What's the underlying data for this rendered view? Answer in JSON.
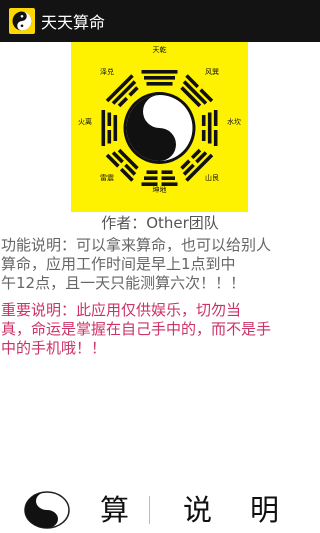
{
  "app": {
    "title": "天天算命",
    "icon": "yin-yang-icon"
  },
  "bagua": {
    "labels": {
      "top": "天乾",
      "top_right": "风巽",
      "right": "水坎",
      "bottom_right": "山艮",
      "bottom": "坤地",
      "bottom_left": "雷震",
      "left": "火离",
      "top_left": "泽兑"
    },
    "colors": {
      "background": "#fff200",
      "ink": "#111111"
    }
  },
  "author": "作者：Other团队",
  "description": {
    "line1": "功能说明：可以拿来算命，也可以给别人",
    "line2": "算命，应用工作时间是早上1点到中",
    "line3": "午12点，且一天只能测算六次！！！"
  },
  "important": {
    "line1": "重要说明：此应用仅供娱乐，切勿当",
    "line2": "真，命运是掌握在自己手中的，而不是手",
    "line3": "中的手机哦！！"
  },
  "nav": {
    "items": [
      {
        "label": "算",
        "icon": "yin-yang-icon"
      },
      {
        "label": "说"
      },
      {
        "label": "明"
      }
    ]
  },
  "colors": {
    "titlebar": "#131313",
    "important_text": "#cc3366",
    "body_text": "#666666"
  }
}
